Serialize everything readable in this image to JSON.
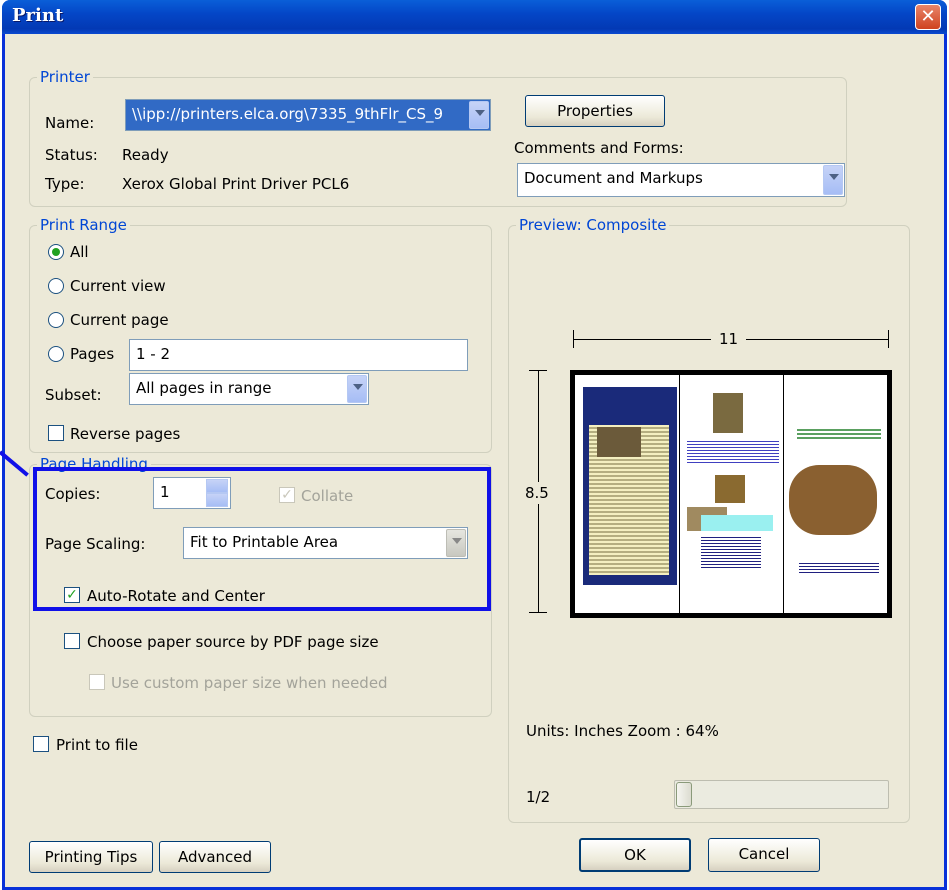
{
  "window": {
    "title": "Print"
  },
  "printer": {
    "legend": "Printer",
    "name_label": "Name:",
    "name_value": "\\\\ipp://printers.elca.org\\7335_9thFlr_CS_9",
    "status_label": "Status:",
    "status_value": "Ready",
    "type_label": "Type:",
    "type_value": "Xerox Global Print Driver PCL6",
    "properties_button": "Properties",
    "comments_label": "Comments and Forms:",
    "comments_value": "Document and Markups"
  },
  "print_range": {
    "legend": "Print Range",
    "all": "All",
    "current_view": "Current view",
    "current_page": "Current page",
    "pages": "Pages",
    "pages_value": "1 - 2",
    "subset_label": "Subset:",
    "subset_value": "All pages in range",
    "reverse_pages": "Reverse pages"
  },
  "page_handling": {
    "legend": "Page Handling",
    "copies_label": "Copies:",
    "copies_value": "1",
    "collate": "Collate",
    "scaling_label": "Page Scaling:",
    "scaling_value": "Fit to Printable Area",
    "auto_rotate": "Auto-Rotate and Center",
    "paper_source": "Choose paper source by PDF page size",
    "custom_paper": "Use custom paper size when needed"
  },
  "print_to_file": "Print to file",
  "preview": {
    "legend": "Preview: Composite",
    "width_label": "11",
    "height_label": "8.5",
    "units_zoom": "Units: Inches Zoom :  64%",
    "page_counter": "1/2"
  },
  "buttons": {
    "printing_tips": "Printing Tips",
    "advanced": "Advanced",
    "ok": "OK",
    "cancel": "Cancel"
  },
  "colors": {
    "title_bar": "#0446c7",
    "legend_text": "#0046d5",
    "highlight_box": "#1010e8",
    "check_mark": "#21a121"
  }
}
